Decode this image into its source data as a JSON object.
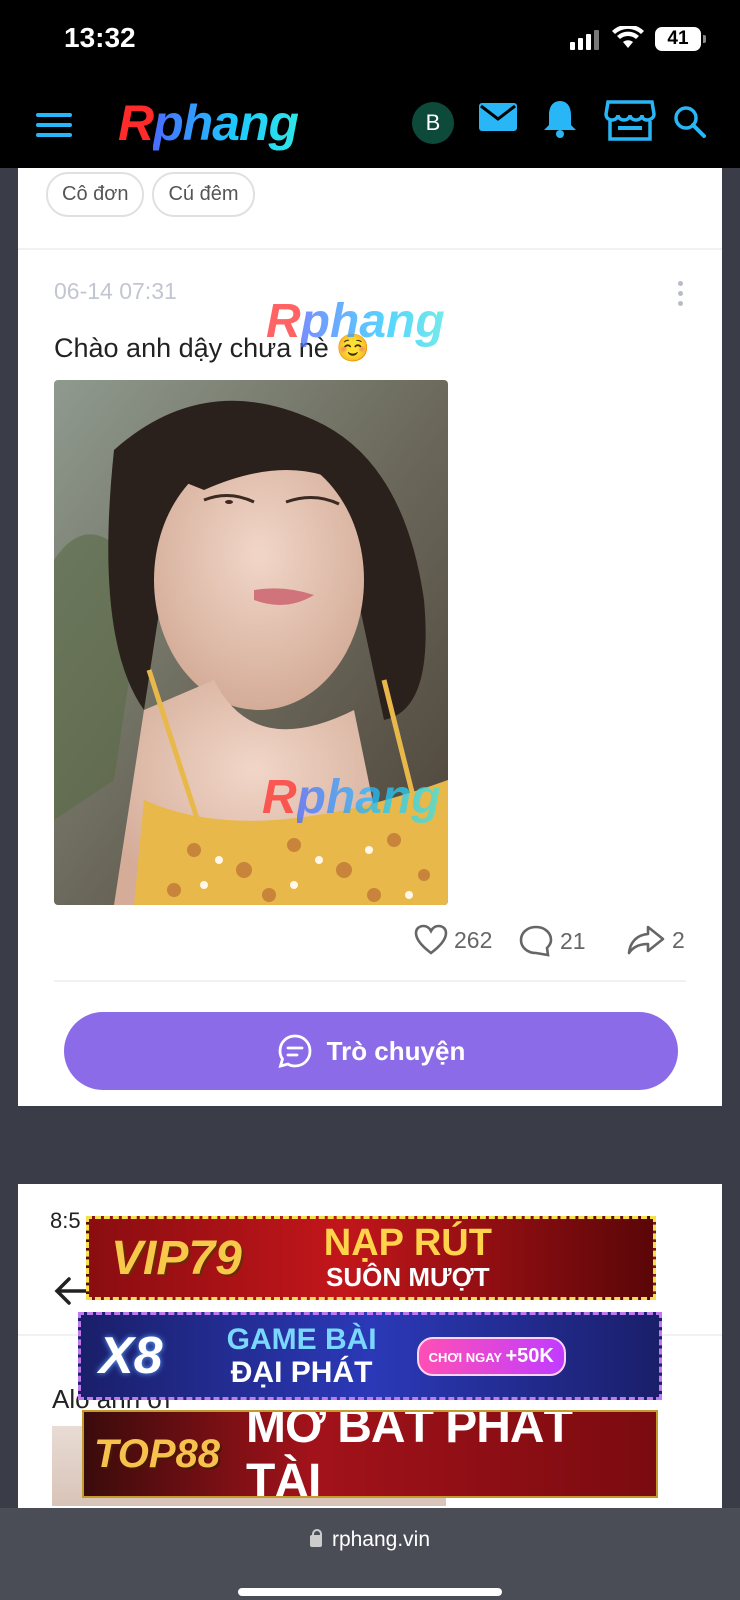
{
  "status_bar": {
    "time": "13:32",
    "battery": "41"
  },
  "header": {
    "logo_r": "R",
    "logo_rest": "phang",
    "avatar_initial": "B"
  },
  "tags": [
    "Cô đơn",
    "Cú đêm"
  ],
  "post": {
    "timestamp": "06-14 07:31",
    "text": "Chào anh dậy chưa nè ☺️",
    "watermark_r": "R",
    "watermark_rest": "phang",
    "likes": "262",
    "comments": "21",
    "shares": "2",
    "chat_label": "Trò chuyện"
  },
  "second_post": {
    "time": "8:5",
    "text": "Alo anh ơi"
  },
  "ads": [
    {
      "brand": "VIP79",
      "line1": "NẠP RÚT",
      "line2": "SUÔN MƯỢT"
    },
    {
      "brand": "X8",
      "line1": "GAME BÀI",
      "line2": "ĐẠI PHÁT",
      "promo_small": "CHƠI NGAY",
      "promo_big": "+50K"
    },
    {
      "brand": "TOP88",
      "line1": "MỞ BÁT PHÁT TÀI"
    }
  ],
  "browser": {
    "url": "rphang.vin"
  },
  "colors": {
    "accent_blue": "#29b6f6",
    "chat_purple": "#8b6be8",
    "avatar_green": "#0d4a3a"
  }
}
